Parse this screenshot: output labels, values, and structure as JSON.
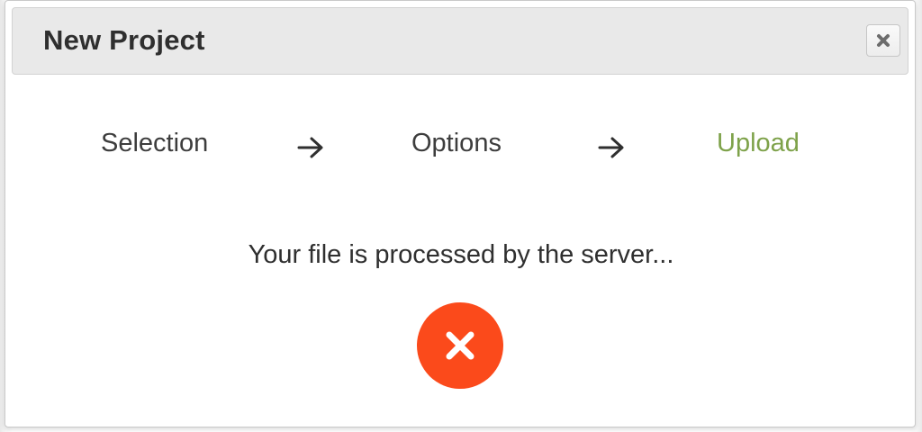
{
  "dialog": {
    "title": "New Project",
    "close_icon": "close-icon"
  },
  "steps": [
    {
      "label": "Selection",
      "state": "done"
    },
    {
      "label": "Options",
      "state": "done"
    },
    {
      "label": "Upload",
      "state": "active"
    }
  ],
  "step_separator_icon": "arrow-right-icon",
  "status": {
    "message": "Your file is processed by the server...",
    "cancel_icon": "cancel-icon"
  },
  "colors": {
    "active_step": "#7ea24a",
    "cancel_button": "#fb4a1b",
    "titlebar": "#e9e9e9"
  }
}
